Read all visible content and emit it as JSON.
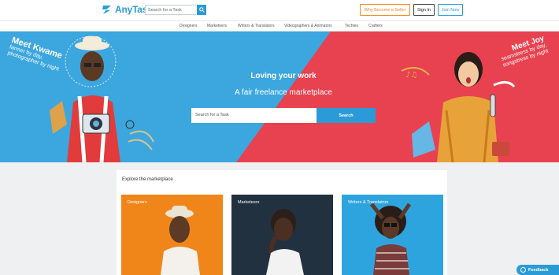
{
  "header": {
    "logo_text": "AnyTask",
    "search_placeholder": "Search for a Task",
    "become_seller": "Why Become a Seller",
    "sign_in": "Sign In",
    "join": "Join Now"
  },
  "categories": [
    "Designers",
    "Marketeers",
    "Writers & Translators",
    "Videographers & Animators",
    "Techies",
    "Crafters"
  ],
  "hero": {
    "title": "Loving your work",
    "subtitle": "A fair freelance marketplace",
    "search_placeholder": "Search for a Task",
    "search_button": "Search",
    "left_name": "Meet Kwame",
    "left_tag1": "farmer by day,",
    "left_tag2": "photographer by night",
    "right_name": "Meet Joy",
    "right_tag1": "seamstress by day,",
    "right_tag2": "songstress by night"
  },
  "explore": {
    "title": "Explore the marketplace",
    "cards": [
      "Designers",
      "Marketeers",
      "Writers & Translators"
    ]
  },
  "feedback": "Feedback",
  "colors": {
    "brand_blue": "#2b9bd8",
    "hero_red": "#e8414f",
    "designers_orange": "#f0861a",
    "marketeers_navy": "#22313f",
    "writers_blue": "#2ea4df"
  }
}
